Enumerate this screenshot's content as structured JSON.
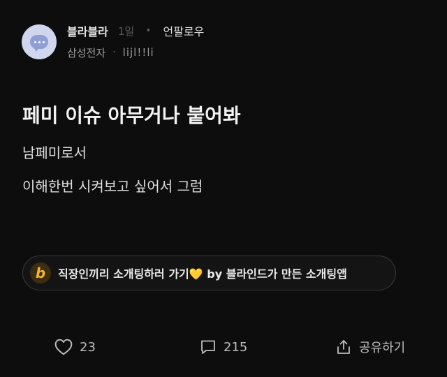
{
  "post": {
    "author": "블라블라",
    "time": "1일",
    "follow_label": "언팔로우",
    "company": "삼성전자",
    "nickname": "lijl!!li",
    "title": "페미 이슈 아무거나 붙어봐",
    "body_lines": [
      "남페미로서",
      "이해한번 시켜보고 싶어서 그럼"
    ]
  },
  "ad": {
    "logo_letter": "b",
    "text": "직장인끼리 소개팅하러 가기💛 by 블라인드가 만든 소개팅앱"
  },
  "actions": {
    "likes": "23",
    "comments": "215",
    "share_label": "공유하기"
  },
  "icons": {
    "avatar": "chat-bubble-icon",
    "like": "heart-icon",
    "comment": "comment-icon",
    "share": "share-icon"
  },
  "colors": {
    "background": "#0d0d0d",
    "avatar_bg": "#cfd6ee",
    "avatar_bubble": "#8f9fd6",
    "ad_logo": "#f3b531"
  }
}
